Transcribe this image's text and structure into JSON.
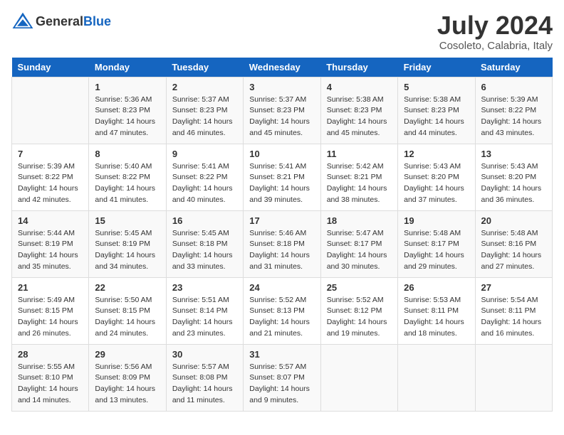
{
  "header": {
    "logo_general": "General",
    "logo_blue": "Blue",
    "month_year": "July 2024",
    "location": "Cosoleto, Calabria, Italy"
  },
  "columns": [
    "Sunday",
    "Monday",
    "Tuesday",
    "Wednesday",
    "Thursday",
    "Friday",
    "Saturday"
  ],
  "weeks": [
    [
      {
        "day": "",
        "sunrise": "",
        "sunset": "",
        "daylight": ""
      },
      {
        "day": "1",
        "sunrise": "Sunrise: 5:36 AM",
        "sunset": "Sunset: 8:23 PM",
        "daylight": "Daylight: 14 hours and 47 minutes."
      },
      {
        "day": "2",
        "sunrise": "Sunrise: 5:37 AM",
        "sunset": "Sunset: 8:23 PM",
        "daylight": "Daylight: 14 hours and 46 minutes."
      },
      {
        "day": "3",
        "sunrise": "Sunrise: 5:37 AM",
        "sunset": "Sunset: 8:23 PM",
        "daylight": "Daylight: 14 hours and 45 minutes."
      },
      {
        "day": "4",
        "sunrise": "Sunrise: 5:38 AM",
        "sunset": "Sunset: 8:23 PM",
        "daylight": "Daylight: 14 hours and 45 minutes."
      },
      {
        "day": "5",
        "sunrise": "Sunrise: 5:38 AM",
        "sunset": "Sunset: 8:23 PM",
        "daylight": "Daylight: 14 hours and 44 minutes."
      },
      {
        "day": "6",
        "sunrise": "Sunrise: 5:39 AM",
        "sunset": "Sunset: 8:22 PM",
        "daylight": "Daylight: 14 hours and 43 minutes."
      }
    ],
    [
      {
        "day": "7",
        "sunrise": "Sunrise: 5:39 AM",
        "sunset": "Sunset: 8:22 PM",
        "daylight": "Daylight: 14 hours and 42 minutes."
      },
      {
        "day": "8",
        "sunrise": "Sunrise: 5:40 AM",
        "sunset": "Sunset: 8:22 PM",
        "daylight": "Daylight: 14 hours and 41 minutes."
      },
      {
        "day": "9",
        "sunrise": "Sunrise: 5:41 AM",
        "sunset": "Sunset: 8:22 PM",
        "daylight": "Daylight: 14 hours and 40 minutes."
      },
      {
        "day": "10",
        "sunrise": "Sunrise: 5:41 AM",
        "sunset": "Sunset: 8:21 PM",
        "daylight": "Daylight: 14 hours and 39 minutes."
      },
      {
        "day": "11",
        "sunrise": "Sunrise: 5:42 AM",
        "sunset": "Sunset: 8:21 PM",
        "daylight": "Daylight: 14 hours and 38 minutes."
      },
      {
        "day": "12",
        "sunrise": "Sunrise: 5:43 AM",
        "sunset": "Sunset: 8:20 PM",
        "daylight": "Daylight: 14 hours and 37 minutes."
      },
      {
        "day": "13",
        "sunrise": "Sunrise: 5:43 AM",
        "sunset": "Sunset: 8:20 PM",
        "daylight": "Daylight: 14 hours and 36 minutes."
      }
    ],
    [
      {
        "day": "14",
        "sunrise": "Sunrise: 5:44 AM",
        "sunset": "Sunset: 8:19 PM",
        "daylight": "Daylight: 14 hours and 35 minutes."
      },
      {
        "day": "15",
        "sunrise": "Sunrise: 5:45 AM",
        "sunset": "Sunset: 8:19 PM",
        "daylight": "Daylight: 14 hours and 34 minutes."
      },
      {
        "day": "16",
        "sunrise": "Sunrise: 5:45 AM",
        "sunset": "Sunset: 8:18 PM",
        "daylight": "Daylight: 14 hours and 33 minutes."
      },
      {
        "day": "17",
        "sunrise": "Sunrise: 5:46 AM",
        "sunset": "Sunset: 8:18 PM",
        "daylight": "Daylight: 14 hours and 31 minutes."
      },
      {
        "day": "18",
        "sunrise": "Sunrise: 5:47 AM",
        "sunset": "Sunset: 8:17 PM",
        "daylight": "Daylight: 14 hours and 30 minutes."
      },
      {
        "day": "19",
        "sunrise": "Sunrise: 5:48 AM",
        "sunset": "Sunset: 8:17 PM",
        "daylight": "Daylight: 14 hours and 29 minutes."
      },
      {
        "day": "20",
        "sunrise": "Sunrise: 5:48 AM",
        "sunset": "Sunset: 8:16 PM",
        "daylight": "Daylight: 14 hours and 27 minutes."
      }
    ],
    [
      {
        "day": "21",
        "sunrise": "Sunrise: 5:49 AM",
        "sunset": "Sunset: 8:15 PM",
        "daylight": "Daylight: 14 hours and 26 minutes."
      },
      {
        "day": "22",
        "sunrise": "Sunrise: 5:50 AM",
        "sunset": "Sunset: 8:15 PM",
        "daylight": "Daylight: 14 hours and 24 minutes."
      },
      {
        "day": "23",
        "sunrise": "Sunrise: 5:51 AM",
        "sunset": "Sunset: 8:14 PM",
        "daylight": "Daylight: 14 hours and 23 minutes."
      },
      {
        "day": "24",
        "sunrise": "Sunrise: 5:52 AM",
        "sunset": "Sunset: 8:13 PM",
        "daylight": "Daylight: 14 hours and 21 minutes."
      },
      {
        "day": "25",
        "sunrise": "Sunrise: 5:52 AM",
        "sunset": "Sunset: 8:12 PM",
        "daylight": "Daylight: 14 hours and 19 minutes."
      },
      {
        "day": "26",
        "sunrise": "Sunrise: 5:53 AM",
        "sunset": "Sunset: 8:11 PM",
        "daylight": "Daylight: 14 hours and 18 minutes."
      },
      {
        "day": "27",
        "sunrise": "Sunrise: 5:54 AM",
        "sunset": "Sunset: 8:11 PM",
        "daylight": "Daylight: 14 hours and 16 minutes."
      }
    ],
    [
      {
        "day": "28",
        "sunrise": "Sunrise: 5:55 AM",
        "sunset": "Sunset: 8:10 PM",
        "daylight": "Daylight: 14 hours and 14 minutes."
      },
      {
        "day": "29",
        "sunrise": "Sunrise: 5:56 AM",
        "sunset": "Sunset: 8:09 PM",
        "daylight": "Daylight: 14 hours and 13 minutes."
      },
      {
        "day": "30",
        "sunrise": "Sunrise: 5:57 AM",
        "sunset": "Sunset: 8:08 PM",
        "daylight": "Daylight: 14 hours and 11 minutes."
      },
      {
        "day": "31",
        "sunrise": "Sunrise: 5:57 AM",
        "sunset": "Sunset: 8:07 PM",
        "daylight": "Daylight: 14 hours and 9 minutes."
      },
      {
        "day": "",
        "sunrise": "",
        "sunset": "",
        "daylight": ""
      },
      {
        "day": "",
        "sunrise": "",
        "sunset": "",
        "daylight": ""
      },
      {
        "day": "",
        "sunrise": "",
        "sunset": "",
        "daylight": ""
      }
    ]
  ]
}
